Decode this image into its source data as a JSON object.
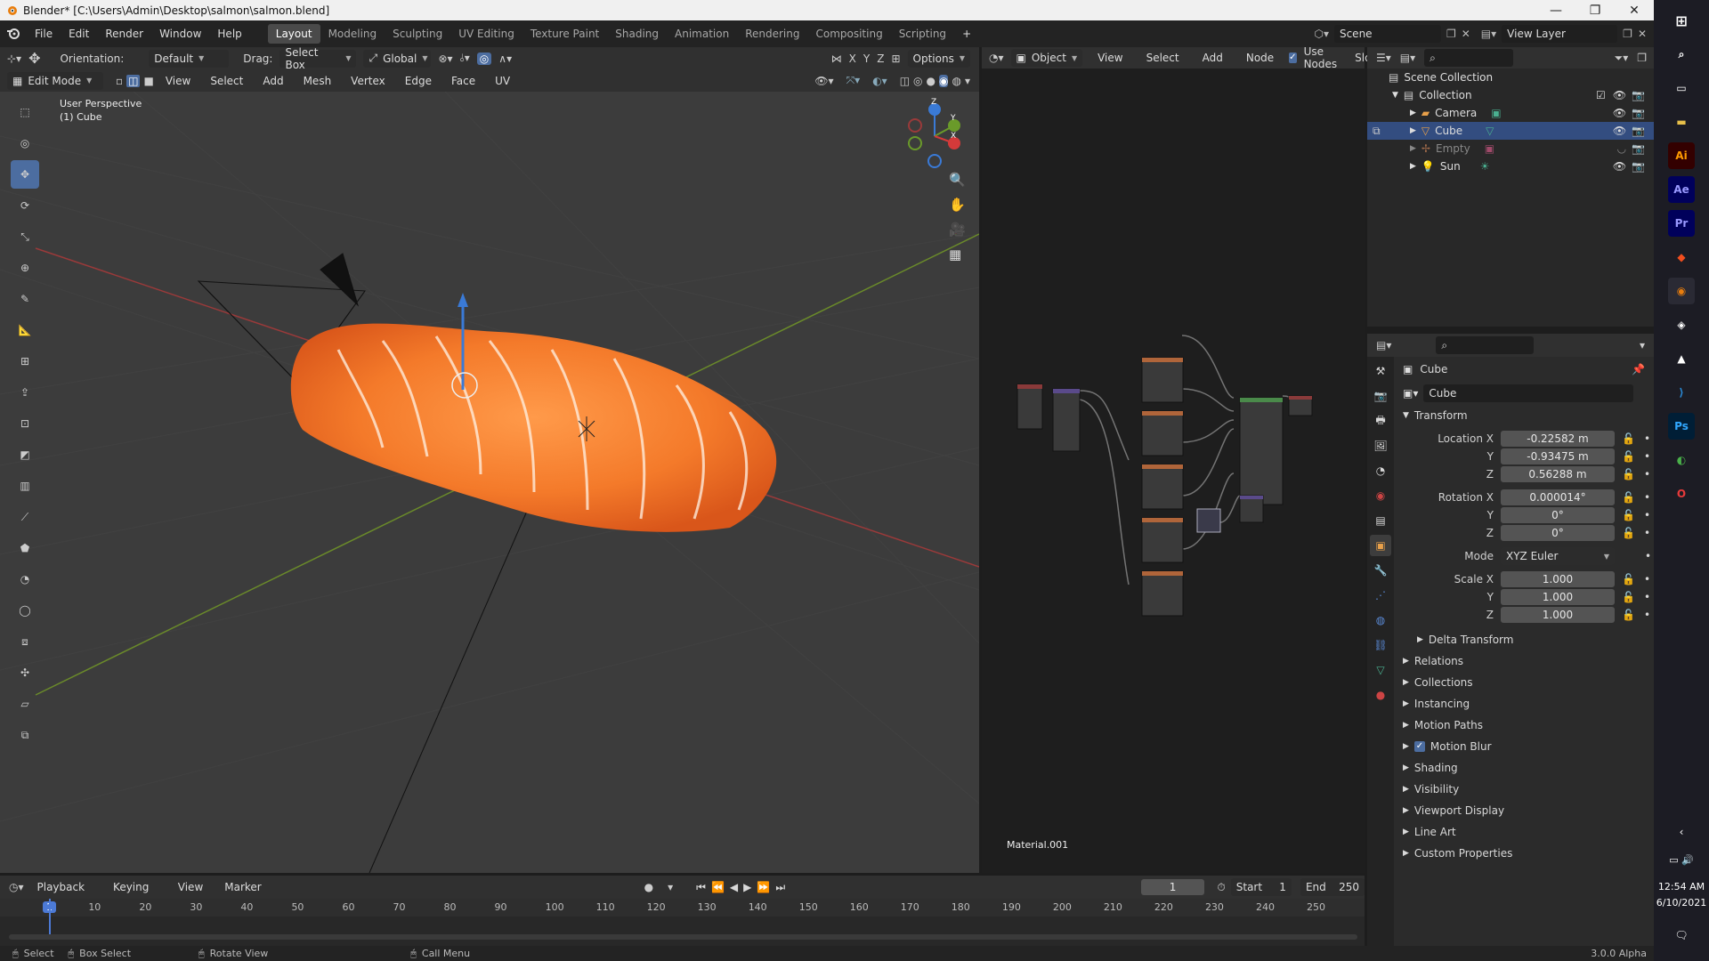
{
  "window": {
    "title": "Blender* [C:\\Users\\Admin\\Desktop\\salmon\\salmon.blend]"
  },
  "menus": [
    "File",
    "Edit",
    "Render",
    "Window",
    "Help"
  ],
  "workspaces": [
    "Layout",
    "Modeling",
    "Sculpting",
    "UV Editing",
    "Texture Paint",
    "Shading",
    "Animation",
    "Rendering",
    "Compositing",
    "Scripting"
  ],
  "scene": {
    "name": "Scene",
    "view_layer": "View Layer"
  },
  "viewport_header": {
    "orientation_label": "Orientation:",
    "orientation_value": "Default",
    "drag_label": "Drag:",
    "drag_value": "Select Box",
    "transform_value": "Global",
    "axes": [
      "X",
      "Y",
      "Z"
    ],
    "options": "Options",
    "mode": "Edit Mode",
    "menus": [
      "View",
      "Select",
      "Add",
      "Mesh",
      "Vertex",
      "Edge",
      "Face",
      "UV"
    ]
  },
  "viewport": {
    "perspective": "User Perspective",
    "object": "(1) Cube",
    "gizmo": {
      "x": "X",
      "y": "Y",
      "z": "Z"
    }
  },
  "node_editor": {
    "object_dropdown": "Object",
    "menus": [
      "View",
      "Select",
      "Add",
      "Node"
    ],
    "use_nodes": "Use Nodes",
    "slot": "Slot",
    "material": "Material.001"
  },
  "outliner": {
    "root": "Scene Collection",
    "collection": "Collection",
    "items": [
      {
        "name": "Camera"
      },
      {
        "name": "Cube"
      },
      {
        "name": "Empty"
      },
      {
        "name": "Sun"
      }
    ]
  },
  "properties": {
    "object_name": "Cube",
    "data_name": "Cube",
    "transform_title": "Transform",
    "location_x_label": "Location X",
    "location": [
      "-0.22582 m",
      "-0.93475 m",
      "0.56288 m"
    ],
    "rotation_x_label": "Rotation X",
    "rotation": [
      "0.000014°",
      "0°",
      "0°"
    ],
    "mode_label": "Mode",
    "mode_value": "XYZ Euler",
    "scale_x_label": "Scale X",
    "scale": [
      "1.000",
      "1.000",
      "1.000"
    ],
    "y_label": "Y",
    "z_label": "Z",
    "delta": "Delta Transform",
    "panels": [
      "Relations",
      "Collections",
      "Instancing",
      "Motion Paths",
      "Motion Blur",
      "Shading",
      "Visibility",
      "Viewport Display",
      "Line Art",
      "Custom Properties"
    ]
  },
  "timeline": {
    "menus": [
      "Playback",
      "Keying",
      "View",
      "Marker"
    ],
    "current_frame": "1",
    "start_label": "Start",
    "start": "1",
    "end_label": "End",
    "end": "250",
    "ticks": [
      "1",
      "10",
      "20",
      "30",
      "40",
      "50",
      "60",
      "70",
      "80",
      "90",
      "100",
      "110",
      "120",
      "130",
      "140",
      "150",
      "160",
      "170",
      "180",
      "190",
      "200",
      "210",
      "220",
      "230",
      "240",
      "250"
    ]
  },
  "statusbar": {
    "select": "Select",
    "box_select": "Box Select",
    "rotate_view": "Rotate View",
    "call_menu": "Call Menu",
    "version": "3.0.0 Alpha"
  },
  "taskbar": {
    "time": "12:54 AM",
    "date": "6/10/2021",
    "apps": [
      "Ai",
      "Ae",
      "Pr",
      "Ps"
    ]
  }
}
